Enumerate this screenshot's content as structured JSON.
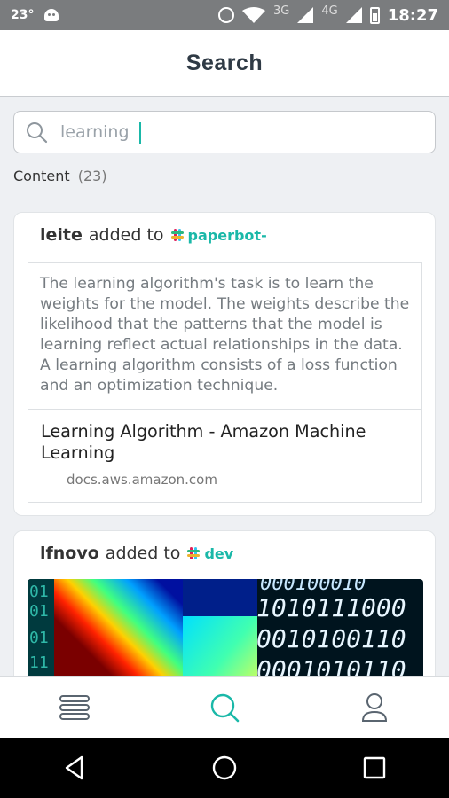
{
  "status_bar": {
    "temperature": "23°",
    "net_3g": "3G",
    "net_4g": "4G",
    "time": "18:27"
  },
  "header": {
    "title": "Search"
  },
  "search": {
    "value": "learning",
    "placeholder": ""
  },
  "results": {
    "label": "Content",
    "count": "(23)"
  },
  "cards": [
    {
      "user": "leite",
      "action": "added to",
      "channel": "paperbot-",
      "quote": "The learning algorithm's task is to learn the weights for the model. The weights describe the likelihood that the patterns that the model is learning reflect actual relationships in the data. A learning algorithm consists of a loss function and an optimization technique.",
      "link_title": "Learning Algorithm - Amazon Machine Learning",
      "link_domain": "docs.aws.amazon.com"
    },
    {
      "user": "lfnovo",
      "action": "added to",
      "channel": "dev",
      "image_binary_lines": [
        "1010111000",
        "0010100110",
        "0001010110"
      ]
    }
  ],
  "colors": {
    "accent": "#1ab8a8",
    "nav_inactive": "#5a6570"
  },
  "bottom_nav": [
    {
      "icon": "feed-icon",
      "active": false
    },
    {
      "icon": "search-icon",
      "active": true
    },
    {
      "icon": "profile-icon",
      "active": false
    }
  ]
}
